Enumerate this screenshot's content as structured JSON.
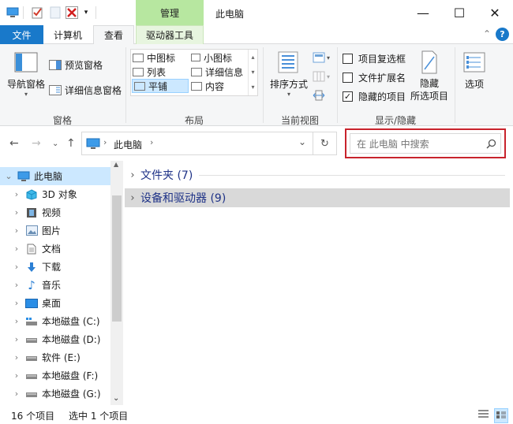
{
  "window": {
    "title": "此电脑",
    "context_tab": "管理",
    "controls": {
      "minimize": "—",
      "maximize": "☐",
      "close": "✕"
    }
  },
  "tabs": [
    {
      "label": "文件"
    },
    {
      "label": "计算机"
    },
    {
      "label": "查看"
    },
    {
      "label": "驱动器工具"
    }
  ],
  "ribbon": {
    "panes": {
      "nav_pane": "导航窗格",
      "preview_pane": "预览窗格",
      "details_pane": "详细信息窗格",
      "group_label": "窗格"
    },
    "layout": {
      "items": [
        "中图标",
        "小图标",
        "列表",
        "详细信息",
        "平铺",
        "内容"
      ],
      "selected": "平铺",
      "group_label": "布局"
    },
    "current_view": {
      "sort_by": "排序方式",
      "group_label": "当前视图"
    },
    "show_hide": {
      "item_checkboxes": {
        "label": "项目复选框",
        "checked": false
      },
      "file_extensions": {
        "label": "文件扩展名",
        "checked": false
      },
      "hidden_items": {
        "label": "隐藏的项目",
        "checked": true
      },
      "hide_selected_line1": "隐藏",
      "hide_selected_line2": "所选项目",
      "group_label": "显示/隐藏"
    },
    "options": "选项"
  },
  "address": {
    "location": "此电脑",
    "search_placeholder": "在 此电脑 中搜索"
  },
  "nav_tree": [
    {
      "label": "此电脑",
      "icon": "computer-icon",
      "selected": true
    },
    {
      "label": "3D 对象",
      "icon": "cube-3d-icon"
    },
    {
      "label": "视频",
      "icon": "video-icon"
    },
    {
      "label": "图片",
      "icon": "picture-icon"
    },
    {
      "label": "文档",
      "icon": "document-icon"
    },
    {
      "label": "下载",
      "icon": "download-icon"
    },
    {
      "label": "音乐",
      "icon": "music-icon"
    },
    {
      "label": "桌面",
      "icon": "desktop-icon"
    },
    {
      "label": "本地磁盘 (C:)",
      "icon": "system-drive-icon"
    },
    {
      "label": "本地磁盘 (D:)",
      "icon": "drive-icon"
    },
    {
      "label": "软件 (E:)",
      "icon": "drive-icon"
    },
    {
      "label": "本地磁盘 (F:)",
      "icon": "drive-icon"
    },
    {
      "label": "本地磁盘 (G:)",
      "icon": "drive-icon"
    }
  ],
  "groups": [
    {
      "label": "文件夹 (7)"
    },
    {
      "label": "设备和驱动器 (9)"
    }
  ],
  "status": {
    "item_count": "16 个项目",
    "selection": "选中 1 个项目"
  },
  "colors": {
    "accent": "#1979ca",
    "context_tab": "#b7e7a0",
    "selection": "#cce8ff",
    "highlight_frame": "#c8232c"
  }
}
